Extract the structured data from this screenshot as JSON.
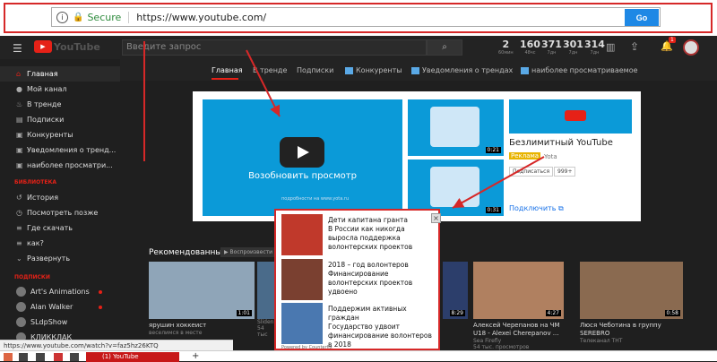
{
  "browser": {
    "secure_label": "Secure",
    "url": "https://www.youtube.com/",
    "go_label": "Go",
    "status_url": "https://www.youtube.com/watch?v=faz5hz26KTQ",
    "tab_title": "(1) YouTube"
  },
  "youtube": {
    "logo_text": "YouTube",
    "logo_region": "RU",
    "search_placeholder": "Введите запрос",
    "stats": [
      {
        "value": "2",
        "label": "60мин"
      },
      {
        "value": "160",
        "label": "48чс"
      },
      {
        "value": "371",
        "label": "7дн"
      },
      {
        "value": "301",
        "label": "7дн"
      },
      {
        "value": "314",
        "label": "7дн"
      }
    ],
    "notifications": "1"
  },
  "sidebar": {
    "items": [
      {
        "icon": "home-icon",
        "label": "Главная"
      },
      {
        "icon": "person-icon",
        "label": "Мой канал"
      },
      {
        "icon": "fire-icon",
        "label": "В тренде"
      },
      {
        "icon": "subscriptions-icon",
        "label": "Подписки"
      },
      {
        "icon": "folder-icon",
        "label": "Конкуренты"
      },
      {
        "icon": "folder-icon",
        "label": "Уведомления о тренд..."
      },
      {
        "icon": "folder-icon",
        "label": "наиболее просматри..."
      }
    ],
    "library_title": "БИБЛИОТЕКА",
    "library_items": [
      {
        "icon": "history-icon",
        "label": "История"
      },
      {
        "icon": "clock-icon",
        "label": "Посмотреть позже"
      },
      {
        "icon": "list-icon",
        "label": "Где скачать"
      },
      {
        "icon": "list-icon",
        "label": "как?"
      },
      {
        "icon": "chevron-down-icon",
        "label": "Развернуть"
      }
    ],
    "subs_title": "ПОДПИСКИ",
    "subscriptions": [
      {
        "label": "Art's Animations",
        "dot": true
      },
      {
        "label": "Alan Walker",
        "dot": true
      },
      {
        "label": "SLdpShow",
        "dot": false
      },
      {
        "label": "КЛИККЛАК",
        "dot": false
      }
    ]
  },
  "tabs": [
    "Главная",
    "В тренде",
    "Подписки",
    "Конкуренты",
    "Уведомления о трендах",
    "наиболее просматриваемое"
  ],
  "ad": {
    "caption": "Возобновить просмотр",
    "caption_small": "подробности на www.yota.ru",
    "thumb1_duration": "0:21",
    "thumb2_duration": "0:31",
    "title": "Безлимитный YouTube",
    "tag": "Реклама",
    "brand": "Yota",
    "subscribe": "Подписаться",
    "sub_count": "999+",
    "link": "Подключить"
  },
  "recommended": {
    "title": "Рекомендованные",
    "play_all": "Воспроизвести все",
    "videos": [
      {
        "title": "ярушин хоккеист",
        "channel": "веселимся в месте",
        "meta": "",
        "duration": "1:01",
        "color": "#8a9bb0"
      },
      {
        "title": "",
        "channel": "Sliden",
        "meta": "54 тыс",
        "duration": "",
        "color": "#4a6b8a"
      },
      {
        "title": "",
        "channel": "",
        "meta": "",
        "duration": "8:29",
        "color": "#2c3e6b"
      },
      {
        "title": "Алексей Черепанов на ЧМ U18 - Alexei Cherepanov ...",
        "channel": "Sea Firefly",
        "meta": "54 тыс. просмотров",
        "duration": "4:27",
        "color": "#b08060"
      },
      {
        "title": "Люся Чеботина в группу SEREBRO",
        "channel": "Телеканал ТНТ",
        "meta": "",
        "duration": "0:58",
        "color": "#8a6a50"
      }
    ]
  },
  "popup": {
    "items": [
      {
        "text": "Дети капитана гранта\nВ России как никогда выросла поддержка волонтерских проектов",
        "color": "#c0392b"
      },
      {
        "text": "2018 – год волонтеров\nФинансирование волонтерских проектов удвоено",
        "color": "#7a4030"
      },
      {
        "text": "Поддержим активных граждан\nГосударство удвоит финансирование волонтеров в 2018",
        "color": "#4a78b0"
      }
    ],
    "powered": "Powered by Counterfix"
  }
}
